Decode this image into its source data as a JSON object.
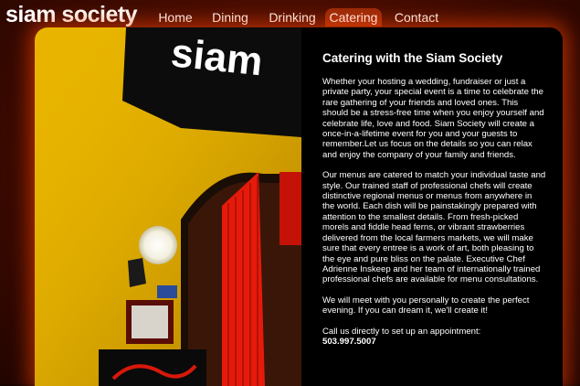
{
  "site": {
    "logo": "siam society"
  },
  "nav": {
    "items": [
      {
        "label": "Home"
      },
      {
        "label": "Dining"
      },
      {
        "label": "Drinking"
      },
      {
        "label": "Catering",
        "active": true
      },
      {
        "label": "Contact"
      }
    ]
  },
  "photo": {
    "sign_text": "siam"
  },
  "main": {
    "heading": "Catering with the Siam Society",
    "paragraph1": "Whether your hosting a wedding, fundraiser or just a private party, your special event is a time to celebrate the rare gathering of your friends and loved ones. This should be a stress-free time when you enjoy yourself and celebrate life, love and food. Siam Society will create a once-in-a-lifetime event for you and your guests to remember.Let us focus on the details so you can relax and enjoy the company of your family and friends.",
    "paragraph2": "Our menus are catered to match your individual taste and style. Our trained staff of professional chefs will create distinctive regional menus or menus from anywhere in the world. Each dish will be painstakingly prepared with attention to the smallest details. From fresh-picked morels and fiddle head ferns, or vibrant strawberries delivered from the local farmers markets, we will make sure that every entree is a work of art, both pleasing to the eye and pure bliss on the palate. Executive Chef Adrienne Inskeep and her team of internationally trained professional chefs are available for menu consultations.",
    "paragraph3": "We will meet with you personally to create the perfect evening. If you can dream it, we'll create it!",
    "contact_line": "Call us directly to set up an appointment:",
    "phone": "503.997.5007"
  },
  "colors": {
    "background": "#4a0d00",
    "glow": "#ff4600",
    "active_tab": "#9a2a08",
    "text": "#ffffff"
  }
}
